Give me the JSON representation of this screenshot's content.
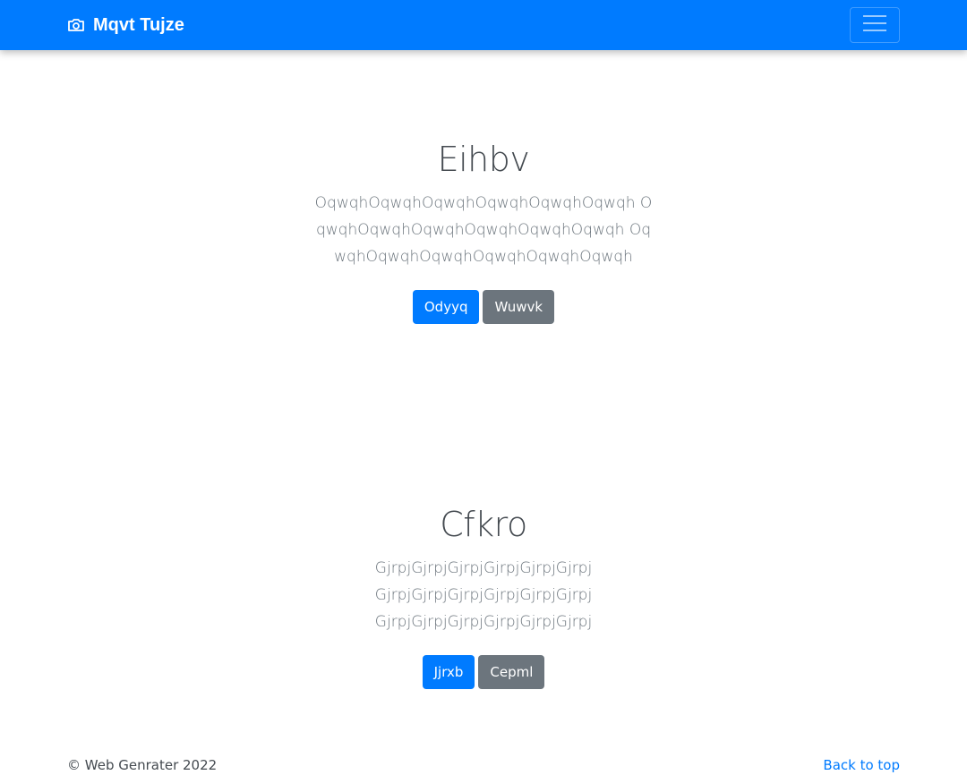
{
  "navbar": {
    "brand_icon": "camera-icon",
    "brand_text": "Mqvt Tujze",
    "toggler_icon": "hamburger-menu-icon",
    "background_color": "#007bff"
  },
  "sections": [
    {
      "title": "Eihbv",
      "text": "OqwqhOqwqhOqwqhOqwqhOqwqhOqwqh OqwqhOqwqhOqwqhOqwqhOqwqhOqwqh OqwqhOqwqhOqwqhOqwqhOqwqhOqwqh",
      "primary_button": "Odyyq",
      "secondary_button": "Wuwvk"
    },
    {
      "title": "Cfkro",
      "text": "GjrpjGjrpjGjrpjGjrpjGjrpjGjrpj GjrpjGjrpjGjrpjGjrpjGjrpjGjrpj GjrpjGjrpjGjrpjGjrpjGjrpjGjrpj",
      "primary_button": "Jjrxb",
      "secondary_button": "Cepml"
    }
  ],
  "footer": {
    "copyright": "© Web Genrater 2022",
    "back_to_top": "Back to top"
  },
  "colors": {
    "primary": "#007bff",
    "secondary": "#6c757d"
  }
}
